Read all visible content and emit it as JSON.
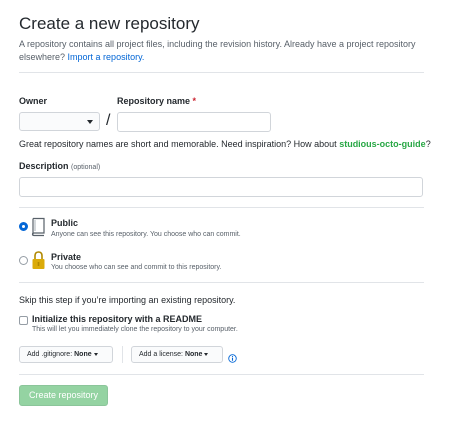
{
  "header": {
    "title": "Create a new repository",
    "subtitle": "A repository contains all project files, including the revision history. Already have a project repository elsewhere?",
    "import_link": "Import a repository."
  },
  "owner": {
    "label": "Owner",
    "value": ""
  },
  "separator": "/",
  "repo_name": {
    "label": "Repository name",
    "required_mark": "*",
    "value": ""
  },
  "hint": {
    "text": "Great repository names are short and memorable. Need inspiration? How about",
    "suggestion": "studious-octo-guide",
    "end": "?"
  },
  "description": {
    "label": "Description",
    "optional": "(optional)",
    "value": ""
  },
  "visibility": {
    "selected": "public",
    "public": {
      "title": "Public",
      "desc": "Anyone can see this repository. You choose who can commit."
    },
    "private": {
      "title": "Private",
      "desc": "You choose who can see and commit to this repository."
    }
  },
  "init": {
    "skip_text": "Skip this step if you’re importing an existing repository.",
    "readme_title": "Initialize this repository with a README",
    "readme_desc": "This will let you immediately clone the repository to your computer.",
    "readme_checked": false
  },
  "gitignore": {
    "label": "Add .gitignore:",
    "value": "None"
  },
  "license": {
    "label": "Add a license:",
    "value": "None"
  },
  "create_button": {
    "label": "Create repository",
    "enabled": false
  },
  "colors": {
    "link": "#0366d6",
    "suggestion": "#28a745",
    "required": "#cb2431",
    "create_button_disabled": "#94d3a2"
  },
  "icons": {
    "public": "repo-book-icon",
    "private": "lock-icon",
    "info": "info-icon"
  }
}
